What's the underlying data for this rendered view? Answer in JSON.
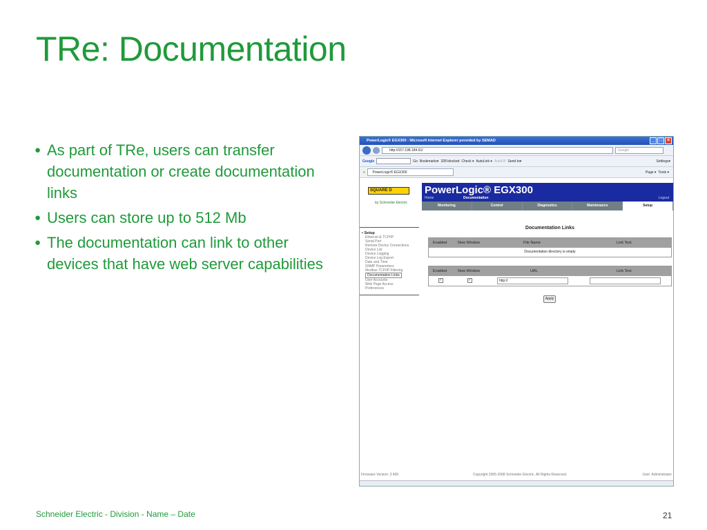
{
  "slide": {
    "title": "TRe: Documentation",
    "bullets": [
      "As part of TRe, users can transfer documentation or create documentation links",
      "Users can store up to 512 Mb",
      "The documentation can link to other devices that have web server capabilities"
    ],
    "footer": "Schneider Electric - Division - Name – Date",
    "page_number": "21"
  },
  "browser": {
    "window_title": "PowerLogic® EGX300 - Microsoft Internet Explorer provided by SEMAD",
    "address": "http://157.198.184.61/",
    "search_placeholder": "Google",
    "toolbar": {
      "google": "Google",
      "go": "Go",
      "bookmarks": "Bookmarks▾",
      "blocked": "328 blocked",
      "check": "Check ▾",
      "autolink": "AutoLink ▾",
      "autofill": "AutoFill",
      "sendto": "Send to▾",
      "settings": "Settings▾",
      "page": "Page ▾",
      "tools": "Tools ▾"
    },
    "tab_label": "PowerLogic® EGX300"
  },
  "app": {
    "brand": "SQUARE D",
    "by": "by Schneider Electric",
    "product_name": "PowerLogic® EGX300",
    "home": "Home",
    "documentation": "Documentation",
    "logout": "Logout",
    "nav": [
      "Monitoring",
      "Control",
      "Diagnostics",
      "Maintenance",
      "Setup"
    ],
    "sidebar": {
      "heading": "Setup",
      "items": [
        "Ethernet & TCP/IP",
        "Serial Port",
        "Remote Device Connections",
        "Device List",
        "Device Logging",
        "Device Log Export",
        "Date and Time",
        "SNMP Parameters",
        "Modbus TCP/IP Filtering",
        "Documentation Links",
        "User Accounts",
        "Web Page Access",
        "Preferences"
      ]
    },
    "heading": "Documentation Links",
    "table1": {
      "headers": [
        "Enabled",
        "New Window",
        "File Name",
        "Link Text"
      ],
      "empty": "Documentation directory is empty"
    },
    "table2": {
      "headers": [
        "Enabled",
        "New Window",
        "URL",
        "Link Text"
      ],
      "url_value": "http://"
    },
    "apply": "Apply",
    "status": {
      "firmware": "Firmware Version:  3.400",
      "copyright": "Copyright 2005-2008 Schneider Electric. All Rights Reserved.",
      "user": "User: Administrator"
    }
  }
}
